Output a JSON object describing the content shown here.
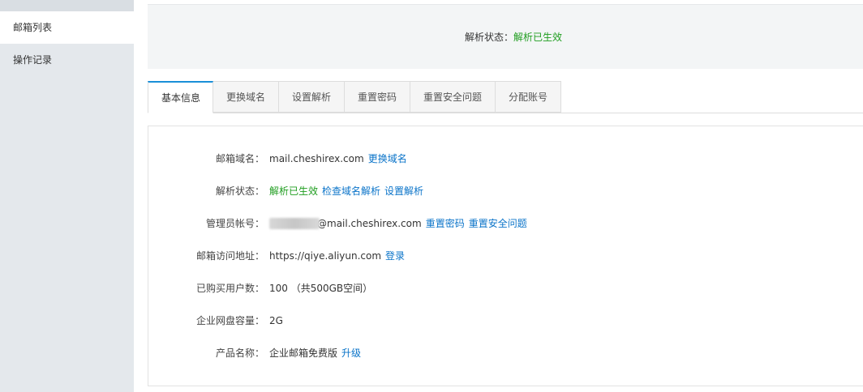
{
  "sidebar": {
    "items": [
      {
        "label": "邮箱列表",
        "active": true
      },
      {
        "label": "操作记录",
        "active": false
      }
    ]
  },
  "banner": {
    "label": "解析状态：",
    "status": "解析已生效"
  },
  "tabs": [
    {
      "label": "基本信息",
      "active": true
    },
    {
      "label": "更换域名",
      "active": false
    },
    {
      "label": "设置解析",
      "active": false
    },
    {
      "label": "重置密码",
      "active": false
    },
    {
      "label": "重置安全问题",
      "active": false
    },
    {
      "label": "分配账号",
      "active": false
    }
  ],
  "info": {
    "domain": {
      "label": "邮箱域名：",
      "value": "mail.cheshirex.com",
      "link": "更换域名"
    },
    "resolve": {
      "label": "解析状态：",
      "status": "解析已生效",
      "link1": "检查域名解析",
      "link2": "设置解析"
    },
    "admin": {
      "label": "管理员帐号：",
      "value": "@mail.cheshirex.com",
      "link1": "重置密码",
      "link2": "重置安全问题"
    },
    "access": {
      "label": "邮箱访问地址：",
      "value": "https://qiye.aliyun.com",
      "link": "登录"
    },
    "users": {
      "label": "已购买用户数：",
      "value": "100 （共500GB空间）"
    },
    "disk": {
      "label": "企业网盘容量：",
      "value": "2G"
    },
    "product": {
      "label": "产品名称：",
      "value": "企业邮箱免费版",
      "link": "升级"
    }
  },
  "colors": {
    "status_green": "#1f9d1f",
    "link_blue": "#0b74c9",
    "tab_accent": "#1a8fd8"
  }
}
